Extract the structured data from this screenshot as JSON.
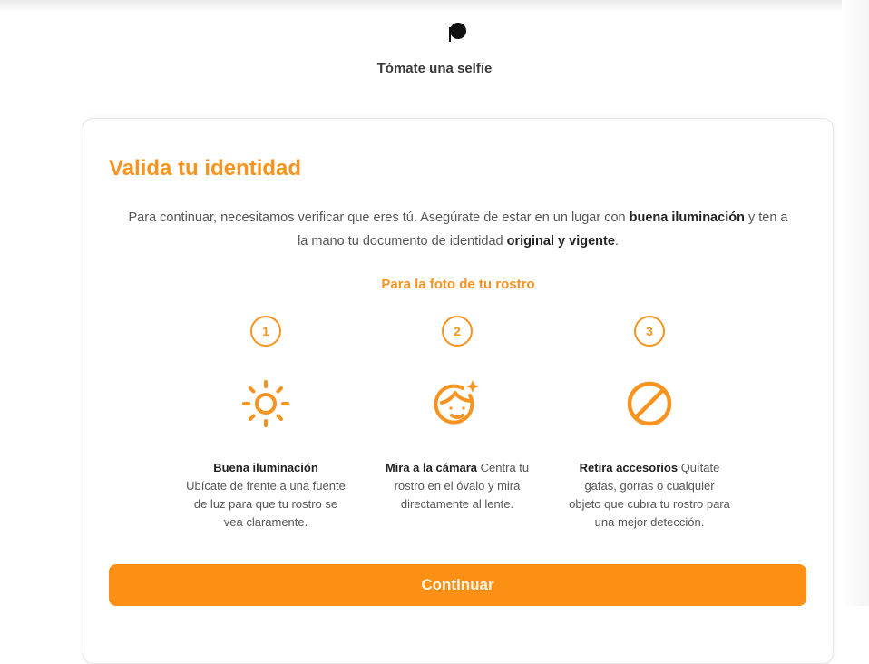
{
  "header": {
    "title": "Tómate una selfie"
  },
  "card": {
    "title": "Valida tu identidad",
    "intro": {
      "part1": "Para continuar, necesitamos verificar que eres tú. Asegúrate de estar en un lugar con ",
      "bold1": "buena iluminación",
      "part2": " y ten a la mano tu documento de identidad ",
      "bold2": "original y vigente",
      "part3": "."
    },
    "subtitle": "Para la foto de tu rostro",
    "steps": [
      {
        "number": "1",
        "icon": "sun-icon",
        "title": "Buena iluminación",
        "text": "Ubícate de frente a una fuente de luz para que tu rostro se vea claramente."
      },
      {
        "number": "2",
        "icon": "face-sparkle-icon",
        "title": "Mira a la cámara",
        "text": "Centra tu rostro en el óvalo y mira directamente al lente."
      },
      {
        "number": "3",
        "icon": "prohibited-icon",
        "title": "Retira accesorios",
        "text": "Quítate gafas, gorras o cualquier objeto que cubra tu rostro para una mejor detección."
      }
    ],
    "continue_label": "Continuar"
  },
  "colors": {
    "accent": "#f7931e",
    "button": "#fb9014",
    "text": "#555555",
    "strong_text": "#222222"
  }
}
